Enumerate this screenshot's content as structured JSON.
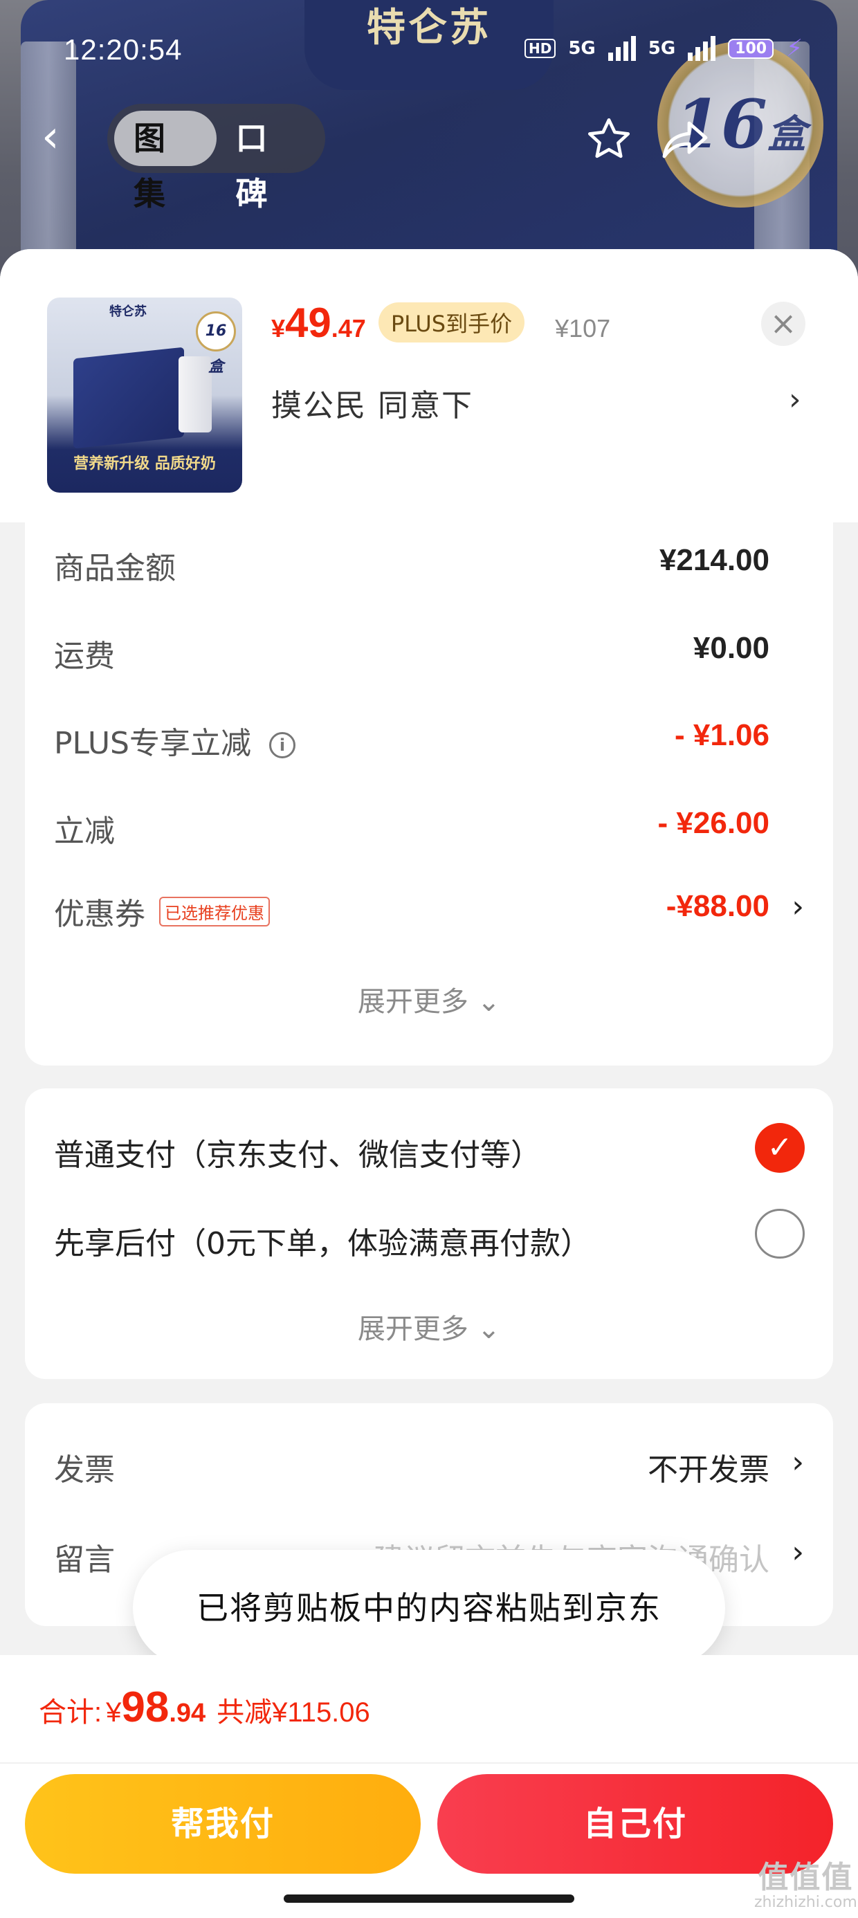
{
  "status_bar": {
    "time": "12:20:54",
    "network_1": "5G",
    "network_2": "5G",
    "hd": "HD",
    "battery": "100"
  },
  "background": {
    "brand": "特仑苏",
    "badge_number": "16",
    "badge_unit": "盒"
  },
  "top_nav": {
    "tabs": [
      {
        "label": "图集",
        "active": true
      },
      {
        "label": "口碑",
        "active": false
      }
    ]
  },
  "product": {
    "thumb_brand": "特仑苏",
    "thumb_badge": "16盒",
    "thumb_slogan": "营养新升级 品质好奶",
    "currency": "¥",
    "price_int": "49",
    "price_dec": ".47",
    "price_tag": "PLUS到手价",
    "original_price": "¥107",
    "address": "摸公民  同意下"
  },
  "summary": {
    "rows": [
      {
        "label": "商品金额",
        "value": "¥214.00"
      },
      {
        "label": "运费",
        "value": "¥0.00"
      },
      {
        "label": "PLUS专享立减",
        "value": "- ¥1.06"
      },
      {
        "label": "立减",
        "value": "- ¥26.00"
      },
      {
        "label": "优惠券",
        "tag": "已选推荐优惠",
        "value": "-¥88.00"
      }
    ],
    "expand_label": "展开更多"
  },
  "payment": {
    "options": [
      {
        "label": "普通支付（京东支付、微信支付等）",
        "selected": true
      },
      {
        "label": "先享后付（0元下单，体验满意再付款）",
        "selected": false
      }
    ],
    "expand_label": "展开更多"
  },
  "extra": {
    "invoice_label": "发票",
    "invoice_value": "不开发票",
    "message_label": "留言",
    "message_placeholder": "建议留言前先与商家沟通确认"
  },
  "toast": "已将剪贴板中的内容粘贴到京东",
  "footer": {
    "total_label": "合计:",
    "currency": "¥",
    "total_int": "98",
    "total_dec": ".94",
    "savings": "共减¥115.06",
    "help_pay_label": "帮我付",
    "self_pay_label": "自己付"
  },
  "watermark": {
    "glyphs": "值值值",
    "site": "zhizhizhi.com"
  },
  "colors": {
    "accent_red": "#f2270c",
    "help_pay_yellow": "#ffb814",
    "self_pay_red": "#f5303a",
    "plus_tag_bg": "#fde8b5"
  }
}
